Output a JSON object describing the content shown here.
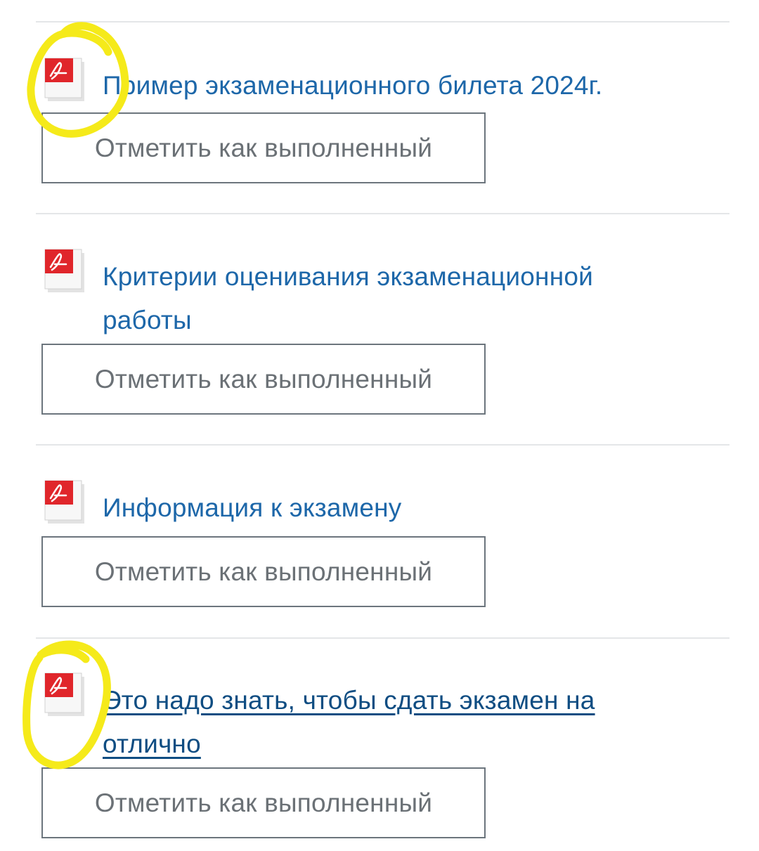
{
  "colors": {
    "link": "#1d67a9",
    "link_visited": "#0f4d82",
    "button_border": "#6c757d",
    "button_text": "#6b7176",
    "divider": "#e4e6e8",
    "pdf_red": "#e0262b",
    "annotation_yellow": "#f5ea1a"
  },
  "activities": [
    {
      "icon": "pdf-icon",
      "title": "Пример экзаменационного билета 2024г.",
      "visited": false,
      "button_label": "Отметить как выполненный"
    },
    {
      "icon": "pdf-icon",
      "title": "Критерии оценивания экзаменационной работы",
      "title_line1": "Критерии оценивания экзаменационной",
      "title_line2": "работы",
      "visited": false,
      "button_label": "Отметить как выполненный"
    },
    {
      "icon": "pdf-icon",
      "title": "Информация к экзамену",
      "visited": false,
      "button_label": "Отметить как выполненный"
    },
    {
      "icon": "pdf-icon",
      "title": "Это надо знать, чтобы сдать экзамен на отлично",
      "title_line1": "Это надо знать, чтобы сдать экзамен на",
      "title_line2": "отлично",
      "visited": true,
      "button_label": "Отметить как выполненный"
    }
  ]
}
